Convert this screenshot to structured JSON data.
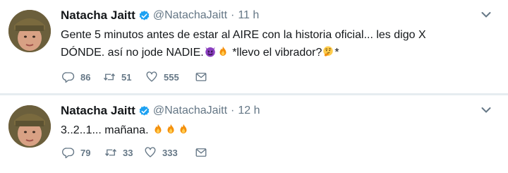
{
  "tweets": [
    {
      "display_name": "Natacha Jaitt",
      "handle": "@NatachaJaitt",
      "separator": "·",
      "time": "11 h",
      "text_line1": "Gente 5 minutos antes de estar al AIRE con la historia oficial... les digo X",
      "text_line2a": "DÓNDE. así no jode NADIE.",
      "text_line2b": " *llevo el vibrador?",
      "text_line2c": "*",
      "emojis": [
        "smiling-devil-icon",
        "fire-icon",
        "thinking-face-icon"
      ],
      "replies": "86",
      "retweets": "51",
      "likes": "555"
    },
    {
      "display_name": "Natacha Jaitt",
      "handle": "@NatachaJaitt",
      "separator": "·",
      "time": "12 h",
      "text": "3..2..1... mañana.",
      "emojis": [
        "fire-icon",
        "fire-icon",
        "fire-icon"
      ],
      "replies": "79",
      "retweets": "33",
      "likes": "333"
    }
  ],
  "colors": {
    "text": "#14171a",
    "secondary": "#657786",
    "verified": "#1da1f2",
    "divider": "#e6ecf0"
  }
}
